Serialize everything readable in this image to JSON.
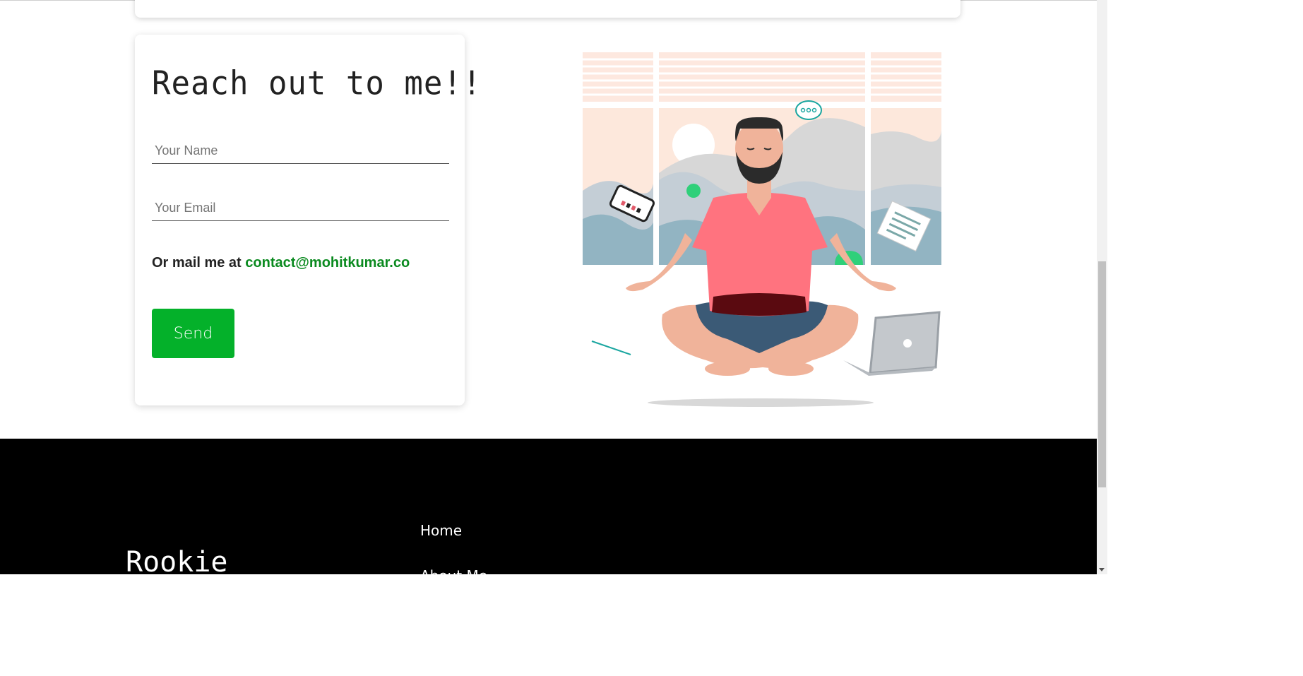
{
  "contact": {
    "title": "Reach out to me!!",
    "name_placeholder": "Your Name",
    "email_placeholder": "Your Email",
    "mail_prefix": "Or mail me at ",
    "mail_address": "contact@mohitkumar.co",
    "send_label": "Send"
  },
  "illustration": {
    "icon": "meditating-developer-illustration"
  },
  "footer": {
    "brand": "Rookie",
    "links": [
      "Home",
      "About Me"
    ]
  },
  "colors": {
    "accent_green": "#04b12a",
    "link_green": "#0a8a1f",
    "footer_bg": "#000000"
  }
}
